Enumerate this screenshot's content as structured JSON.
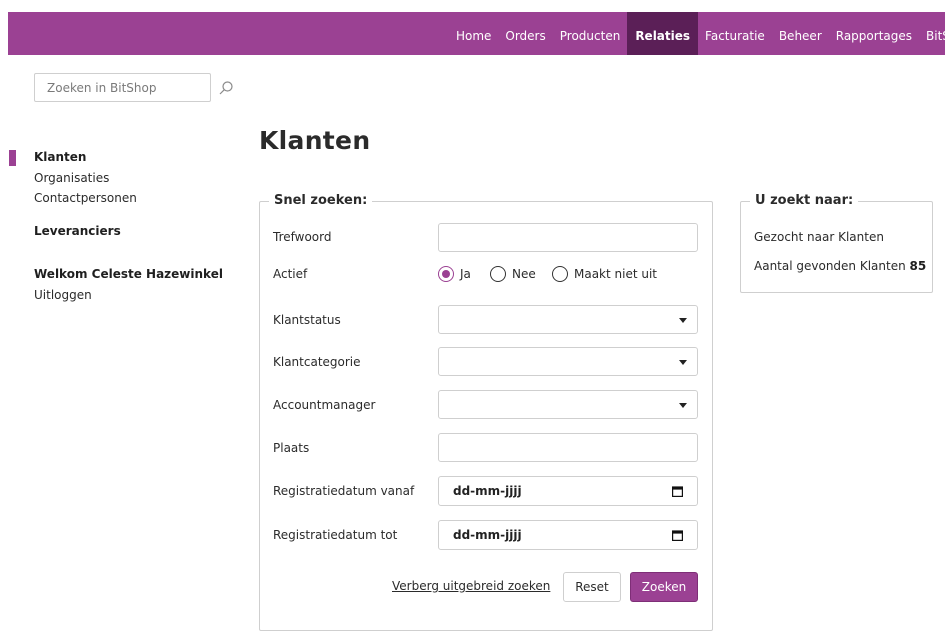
{
  "nav": {
    "items": [
      "Home",
      "Orders",
      "Producten",
      "Relaties",
      "Facturatie",
      "Beheer",
      "Rapportages",
      "BitShop"
    ],
    "active": "Relaties"
  },
  "search": {
    "placeholder": "Zoeken in BitShop",
    "icon": "search-icon"
  },
  "sidebar": {
    "items": [
      "Klanten",
      "Organisaties",
      "Contactpersonen"
    ],
    "active": "Klanten",
    "suppliers": "Leveranciers",
    "welcome": "Welkom Celeste Hazewinkel",
    "logout": "Uitloggen"
  },
  "page": {
    "title": "Klanten"
  },
  "quick_search": {
    "legend": "Snel zoeken:",
    "fields": {
      "keyword": "Trefwoord",
      "active": "Actief",
      "status": "Klantstatus",
      "category": "Klantcategorie",
      "manager": "Accountmanager",
      "city": "Plaats",
      "date_from": "Registratiedatum vanaf",
      "date_to": "Registratiedatum tot"
    },
    "active_options": [
      "Ja",
      "Nee",
      "Maakt niet uit"
    ],
    "active_selected": "Ja",
    "date_placeholder": "dd-mm-jjjj",
    "hide_advanced": "Verberg uitgebreid zoeken",
    "reset": "Reset",
    "submit": "Zoeken"
  },
  "results": {
    "legend": "U zoekt naar:",
    "searched_for": "Gezocht naar Klanten",
    "count_label": "Aantal gevonden Klanten",
    "count": "85"
  },
  "colors": {
    "accent": "#9b4193",
    "accent_dark": "#5b1f57"
  }
}
